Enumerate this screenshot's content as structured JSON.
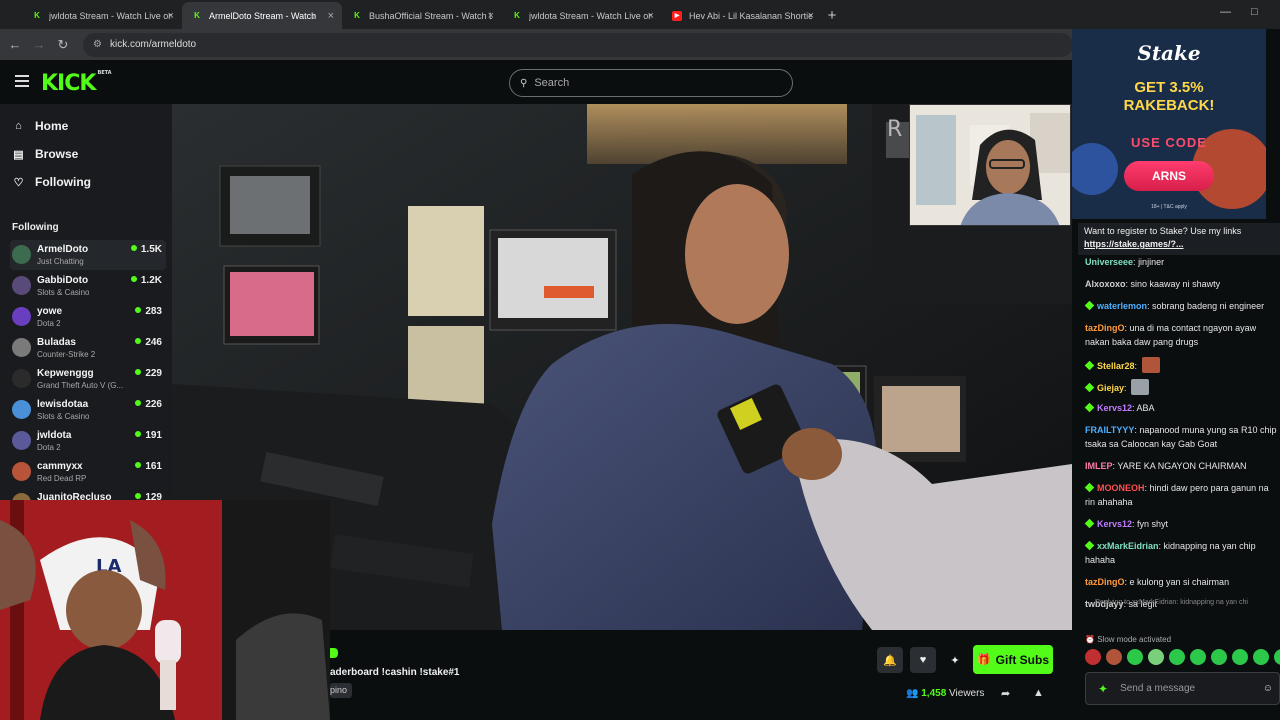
{
  "browser": {
    "tabs": [
      {
        "title": "jwldota Stream - Watch Live on",
        "icon": "kick",
        "active": false
      },
      {
        "title": "ArmelDoto Stream - Watch",
        "icon": "kick",
        "active": true
      },
      {
        "title": "BushaOfficial Stream - Watch Li",
        "icon": "kick",
        "active": false
      },
      {
        "title": "jwldota Stream - Watch Live on",
        "icon": "kick",
        "active": false
      },
      {
        "title": "Hev Abi - Lil Kasalanan Shortie",
        "icon": "youtube",
        "active": false
      }
    ],
    "new_tab": "+",
    "url": "kick.com/armeldoto"
  },
  "header": {
    "logo": "KICK",
    "logo_sup": "BETA",
    "search_placeholder": "Search"
  },
  "sidebar": {
    "nav": [
      {
        "label": "Home",
        "icon": "home-icon"
      },
      {
        "label": "Browse",
        "icon": "browse-icon"
      },
      {
        "label": "Following",
        "icon": "heart-icon"
      }
    ],
    "following_title": "Following",
    "channels": [
      {
        "name": "ArmelDoto",
        "category": "Just Chatting",
        "viewers": "1.5K",
        "color": "#3d6b50"
      },
      {
        "name": "GabbiDoto",
        "category": "Slots & Casino",
        "viewers": "1.2K",
        "color": "#5a4a7a"
      },
      {
        "name": "yowe",
        "category": "Dota 2",
        "viewers": "283",
        "color": "#6a3fbf"
      },
      {
        "name": "Buladas",
        "category": "Counter-Strike 2",
        "viewers": "246",
        "color": "#7a7a7a"
      },
      {
        "name": "Kepwenggg",
        "category": "Grand Theft Auto V (G...",
        "viewers": "229",
        "color": "#2b2b2b"
      },
      {
        "name": "lewisdotaa",
        "category": "Slots & Casino",
        "viewers": "226",
        "color": "#4a90d9"
      },
      {
        "name": "jwldota",
        "category": "Dota 2",
        "viewers": "191",
        "color": "#5a5a9a"
      },
      {
        "name": "cammyxx",
        "category": "Red Dead RP",
        "viewers": "161",
        "color": "#b8543a"
      },
      {
        "name": "JuanitoRecluso",
        "category": "",
        "viewers": "129",
        "color": "#8a6a3a"
      }
    ]
  },
  "stream": {
    "title_fragment": "aderboard !cashin !stake#1",
    "language_fragment": "pino",
    "gift_label": "Gift Subs",
    "viewer_count": "1,458",
    "viewers_label": "Viewers"
  },
  "ad": {
    "brand": "Stake",
    "headline": "GET 3.5% RAKEBACK!",
    "use_code": "USE CODE",
    "code": "ARNS",
    "terms": "18+ | T&C apply"
  },
  "chat": {
    "pinned_text": "Want to register to Stake? Use my links",
    "pinned_link": "https://stake.games/?...",
    "messages": [
      {
        "user": "Universeee",
        "color": "#7ee0c0",
        "text": "jinjiner",
        "badge": false
      },
      {
        "user": "Alxoxoxo",
        "color": "#d0d0d0",
        "text": "sino kaaway ni shawty",
        "badge": false
      },
      {
        "user": "waterlemon",
        "color": "#4fb0ff",
        "text": "sobrang badeng ni engineer",
        "badge": true
      },
      {
        "user": "tazDingO",
        "color": "#ff9a3c",
        "text": "una di ma contact ngayon ayaw nakan baka daw pang drugs",
        "badge": false
      },
      {
        "user": "Stellar28",
        "color": "#ffd84a",
        "text": "",
        "badge": true,
        "emote": "#b0553a"
      },
      {
        "user": "Giejay",
        "color": "#ffd84a",
        "text": "",
        "badge": true,
        "emote": "#9aa0a8"
      },
      {
        "user": "Kervs12",
        "color": "#c07cff",
        "text": "ABA",
        "badge": true
      },
      {
        "user": "FRAILTYYY",
        "color": "#4fb0ff",
        "text": "napanood muna yung sa R10 chip tsaka sa Caloocan kay Gab Goat",
        "badge": false
      },
      {
        "user": "IMLEP",
        "color": "#ff7aa8",
        "text": "YARE KA NGAYON CHAIRMAN",
        "badge": false
      },
      {
        "user": "MOONEOH",
        "color": "#ff5050",
        "text": "hindi daw pero para ganun na rin ahahaha",
        "badge": true
      },
      {
        "user": "Kervs12",
        "color": "#c07cff",
        "text": "fyn shyt",
        "badge": true
      },
      {
        "user": "xxMarkEidrian",
        "color": "#7ee0c0",
        "text": "kidnapping na yan chip hahaha",
        "badge": true
      },
      {
        "user": "tazDingO",
        "color": "#ff9a3c",
        "text": "e kulong yan si chairman",
        "badge": false
      },
      {
        "user": "twbdjayy",
        "color": "#d0d0d0",
        "text": "sa legit",
        "badge": false
      }
    ],
    "reply_text": "Replying to xxMarkEidrian: kidnapping na yan chi",
    "slow_mode": "Slow mode activated",
    "input_placeholder": "Send a message"
  }
}
